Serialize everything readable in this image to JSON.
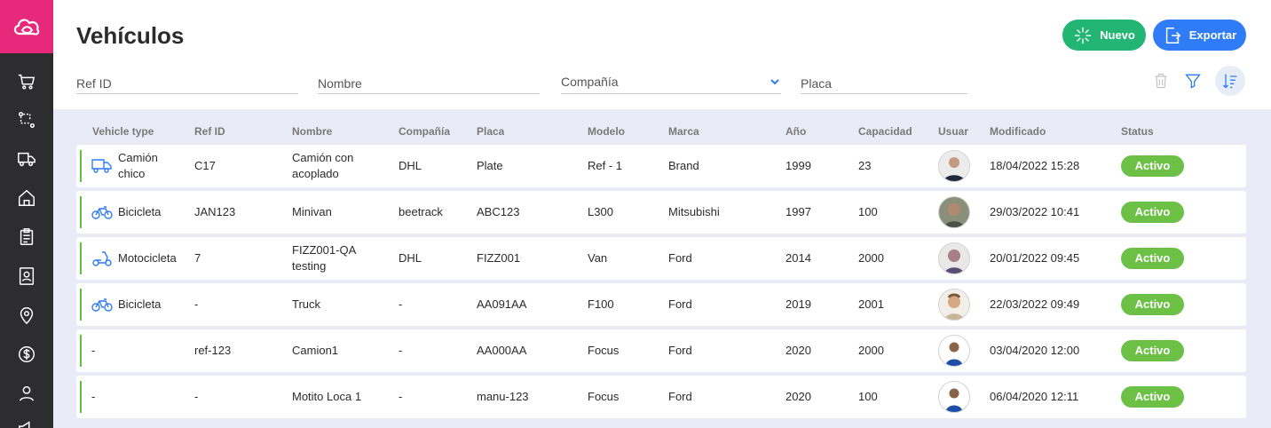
{
  "page": {
    "title": "Vehículos"
  },
  "sidebar": {
    "logo_icon": "cloud-logo-icon",
    "brand_color": "#e8287a",
    "items": [
      {
        "icon": "cart-icon"
      },
      {
        "icon": "route-icon"
      },
      {
        "icon": "truck-icon"
      },
      {
        "icon": "home-icon"
      },
      {
        "icon": "clipboard-icon"
      },
      {
        "icon": "contacts-icon"
      },
      {
        "icon": "location-pin-icon"
      },
      {
        "icon": "dollar-icon"
      },
      {
        "icon": "user-icon"
      },
      {
        "icon": "megaphone-icon"
      }
    ]
  },
  "toolbar": {
    "new_label": "Nuevo",
    "export_label": "Exportar",
    "new_color": "#22b573",
    "export_color": "#2f7cf6"
  },
  "filters": {
    "ref_id": "Ref ID",
    "nombre": "Nombre",
    "compania": "Compañía",
    "placa": "Placa"
  },
  "table": {
    "headers": {
      "vehicle_type": "Vehicle type",
      "ref_id": "Ref ID",
      "nombre": "Nombre",
      "compania": "Compañía",
      "placa": "Placa",
      "modelo": "Modelo",
      "marca": "Marca",
      "anio": "Año",
      "capacidad": "Capacidad",
      "usuario": "Usuario",
      "modificado": "Modificado",
      "status": "Status"
    },
    "rows": [
      {
        "type_icon": "truck-icon",
        "vehicle_type": "Camión chico",
        "ref_id": "C17",
        "nombre": "Camión con acoplado",
        "compania": "DHL",
        "placa": "Plate",
        "modelo": "Ref - 1",
        "marca": "Brand",
        "anio": "1999",
        "capacidad": "23",
        "avatar": "user-avatar",
        "modificado": "18/04/2022 15:28",
        "status": "Activo"
      },
      {
        "type_icon": "bicycle-icon",
        "vehicle_type": "Bicicleta",
        "ref_id": "JAN123",
        "nombre": "Minivan",
        "compania": "beetrack",
        "placa": "ABC123",
        "modelo": "L300",
        "marca": "Mitsubishi",
        "anio": "1997",
        "capacidad": "100",
        "avatar": "user-avatar",
        "modificado": "29/03/2022 10:41",
        "status": "Activo"
      },
      {
        "type_icon": "scooter-icon",
        "vehicle_type": "Motocicleta",
        "ref_id": "7",
        "nombre": "FIZZ001-QA testing",
        "compania": "DHL",
        "placa": "FIZZ001",
        "modelo": "Van",
        "marca": "Ford",
        "anio": "2014",
        "capacidad": "2000",
        "avatar": "user-avatar",
        "modificado": "20/01/2022 09:45",
        "status": "Activo"
      },
      {
        "type_icon": "bicycle-icon",
        "vehicle_type": "Bicicleta",
        "ref_id": "-",
        "nombre": "Truck",
        "compania": "-",
        "placa": "AA091AA",
        "modelo": "F100",
        "marca": "Ford",
        "anio": "2019",
        "capacidad": "2001",
        "avatar": "user-avatar",
        "modificado": "22/03/2022 09:49",
        "status": "Activo"
      },
      {
        "type_icon": "",
        "vehicle_type": "-",
        "ref_id": "ref-123",
        "nombre": "Camion1",
        "compania": "-",
        "placa": "AA000AA",
        "modelo": "Focus",
        "marca": "Ford",
        "anio": "2020",
        "capacidad": "2000",
        "avatar": "user-avatar",
        "modificado": "03/04/2020 12:00",
        "status": "Activo"
      },
      {
        "type_icon": "",
        "vehicle_type": "-",
        "ref_id": "-",
        "nombre": "Motito Loca 1",
        "compania": "-",
        "placa": "manu-123",
        "modelo": "Focus",
        "marca": "Ford",
        "anio": "2020",
        "capacidad": "100",
        "avatar": "user-avatar",
        "modificado": "06/04/2020 12:11",
        "status": "Activo"
      }
    ],
    "status_color": "#6cc045",
    "row_marker_color": "#59c63e"
  }
}
